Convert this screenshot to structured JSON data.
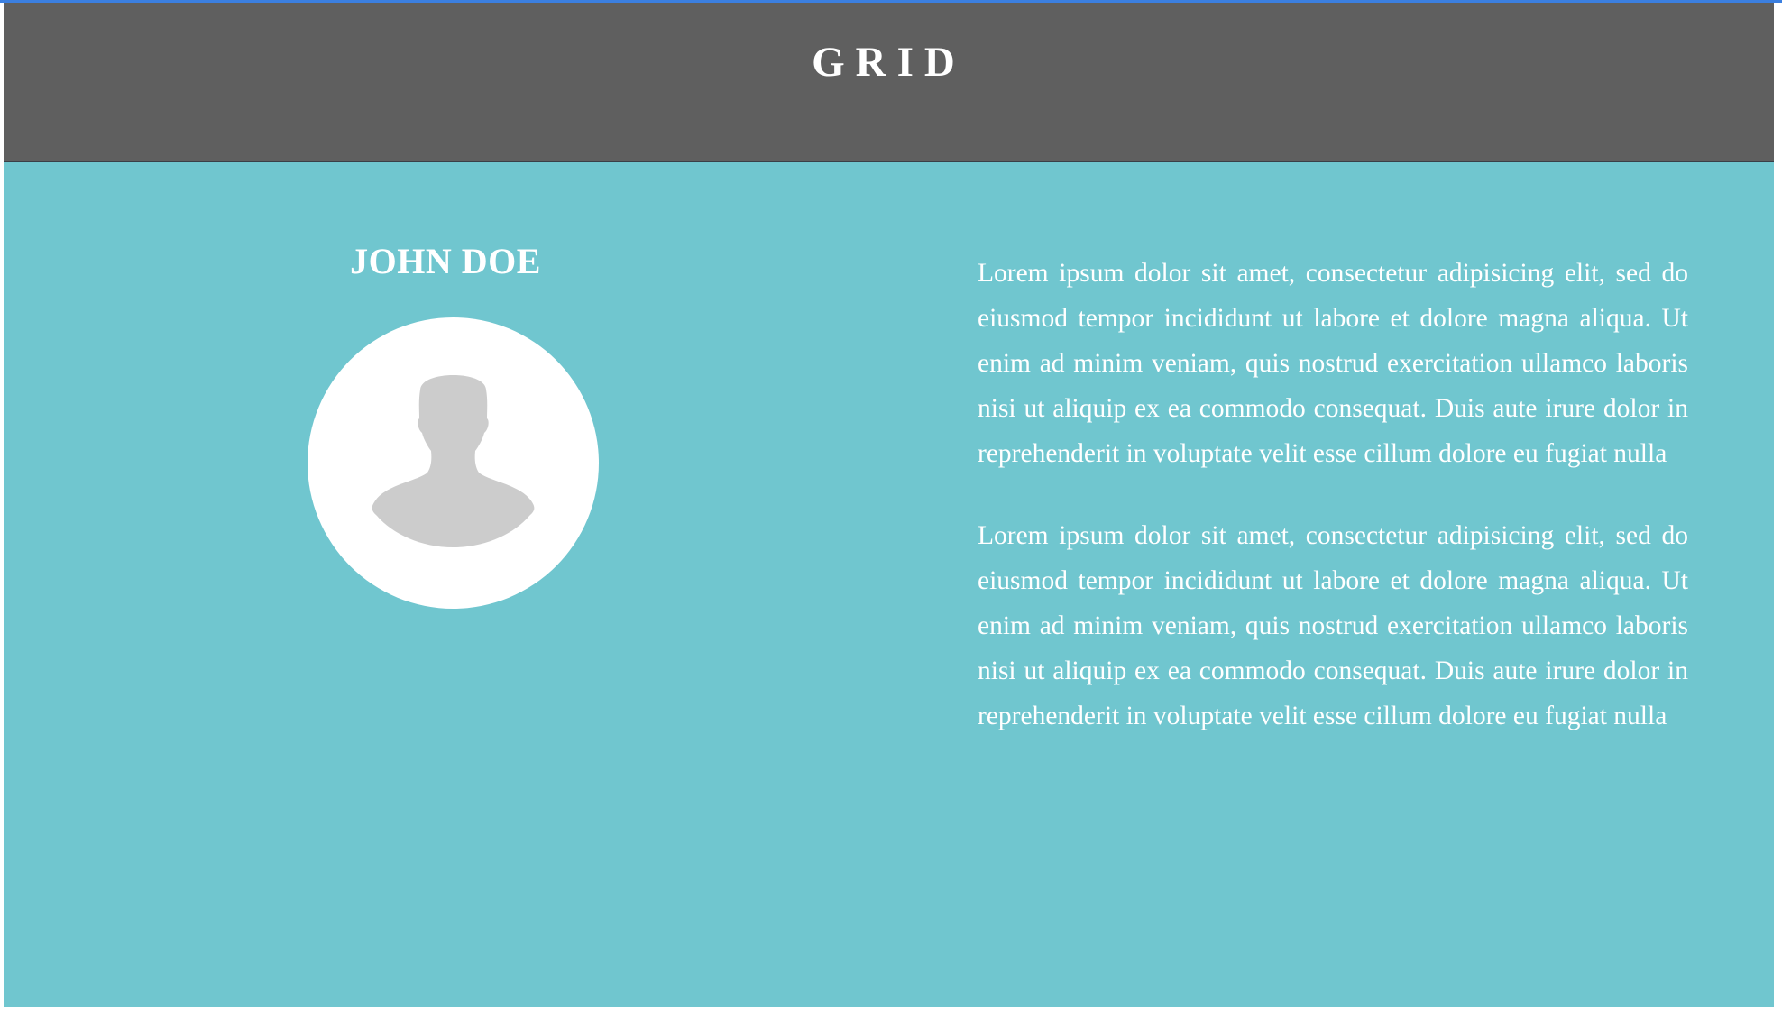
{
  "header": {
    "title": "GRID"
  },
  "profile": {
    "name": "JOHN DOE",
    "avatar_icon": "user-silhouette-icon"
  },
  "content": {
    "paragraphs": [
      "Lorem ipsum dolor sit amet, consectetur adipisicing elit, sed do eiusmod tempor incididunt ut labore et dolore magna aliqua. Ut enim ad minim veniam, quis nostrud exercitation ullamco laboris nisi ut aliquip ex ea commodo consequat. Duis aute irure dolor in reprehenderit in voluptate velit esse cillum dolore eu fugiat nulla",
      "Lorem ipsum dolor sit amet, consectetur adipisicing elit, sed do eiusmod tempor incididunt ut labore et dolore magna aliqua. Ut enim ad minim veniam, quis nostrud exercitation ullamco laboris nisi ut aliquip ex ea commodo consequat. Duis aute irure dolor in reprehenderit in voluptate velit esse cillum dolore eu fugiat nulla"
    ]
  },
  "colors": {
    "header_bg": "#5f5f5f",
    "main_bg": "#70c6cf",
    "text": "#ffffff",
    "avatar_bg": "#ffffff",
    "avatar_figure": "#cccccc",
    "accent_line": "#3b7fe0"
  }
}
